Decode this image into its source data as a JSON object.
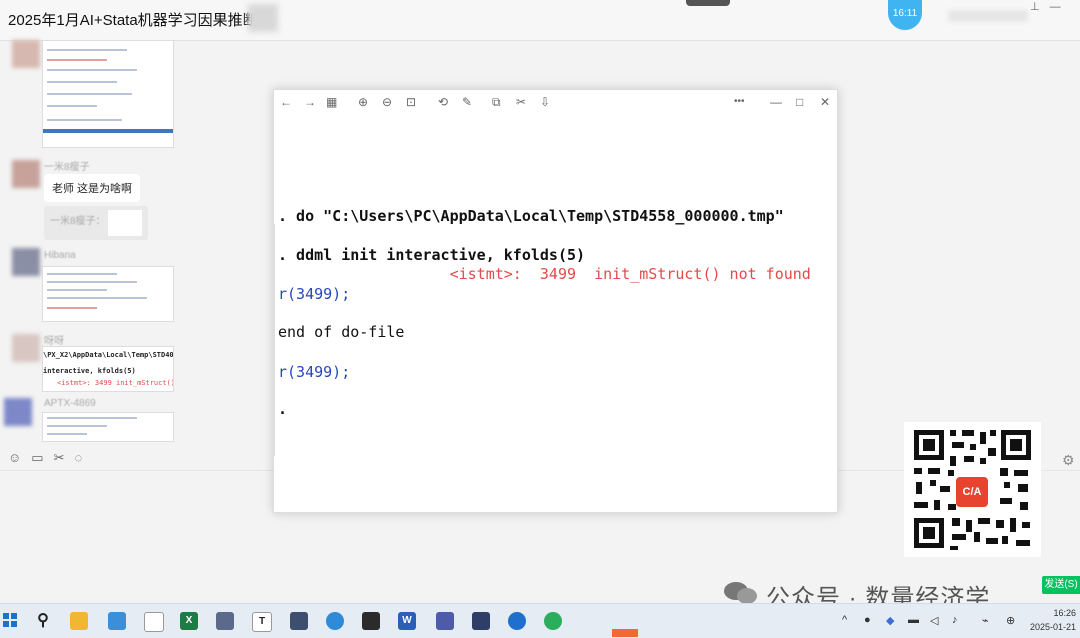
{
  "window": {
    "title": "2025年1月AI+Stata机器学习因果推断",
    "time_badge": "16:11"
  },
  "sidebar": {
    "messages": [
      {
        "sender": "一米8瘦子",
        "text": "老师 这是为啥啊"
      },
      {
        "sender": "一米8瘦子",
        "quote": "一米8瘦子："
      },
      {
        "sender": "Hibana"
      },
      {
        "sender": "呀呀"
      },
      {
        "sender": "APTX-4869"
      }
    ],
    "snippets": {
      "path_line": "\\PX_X2\\AppData\\Local\\Temp\\STD404e0_",
      "cmd_line": "interactive, kfolds(5)",
      "err_line": "<istmt>:  3499  init_mStruct()"
    },
    "toolbar_icons": [
      "emoji-icon",
      "folder-icon",
      "scissors-icon",
      "chat-history-icon"
    ]
  },
  "viewer": {
    "toolbar": {
      "back": "←",
      "forward": "→",
      "grid": "▦",
      "zoom_in": "⊕",
      "zoom_out": "⊖",
      "fit": "⊡",
      "rotate": "⟲",
      "edit": "✎",
      "copy": "⧉",
      "crop": "✂",
      "download": "⇩",
      "more": "•••",
      "minimize": "—",
      "maximize": "□",
      "close": "✕"
    },
    "console": [
      {
        "text": ". do \"C:\\Users\\PC\\AppData\\Local\\Temp\\STD4558_000000.tmp\"",
        "style": "bold"
      },
      {
        "text": ". ddml init interactive, kfolds(5)",
        "style": "bold"
      },
      {
        "text": "                   <istmt>:  3499  init_mStruct() not found",
        "style": "err"
      },
      {
        "text": "r(3499);",
        "style": "rc"
      },
      {
        "text": "end of do-file",
        "style": "plain"
      },
      {
        "text": "r(3499);",
        "style": "rc"
      },
      {
        "text": ".",
        "style": "bold"
      }
    ]
  },
  "qr": {
    "logo_text": "C/A"
  },
  "watermark": {
    "text": "公众号 · 数量经济学"
  },
  "send_button": {
    "label": "发送(S)"
  },
  "taskbar": {
    "search_icon": "⚲",
    "clock_time": "16:26",
    "clock_date": "2025-01-21"
  },
  "colors": {
    "error": "#e34a4a",
    "return_code": "#2848b8",
    "badge": "#40b4f0",
    "send": "#07c160"
  }
}
